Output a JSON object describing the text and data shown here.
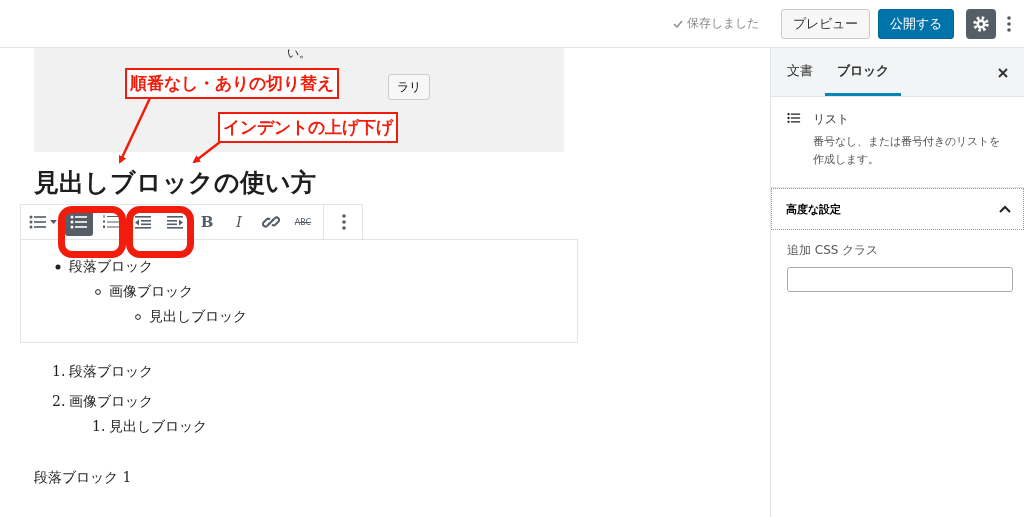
{
  "top_bar": {
    "save_status": "保存しました",
    "buttons": [
      {
        "kind": "secondary",
        "label": "プレビュー"
      },
      {
        "kind": "primary",
        "label": "公開する"
      }
    ],
    "settings_active": true
  },
  "editor": {
    "gallery": {
      "text": "い。",
      "button": "ラリ"
    },
    "heading": "見出しブロックの使い方",
    "toolbar": [
      {
        "kind": "list-type"
      },
      {
        "kind": "unordered",
        "selected": true
      },
      {
        "kind": "ordered",
        "selected": false
      },
      {
        "kind": "outdent"
      },
      {
        "kind": "indent"
      },
      {
        "kind": "bold",
        "label": "B"
      },
      {
        "kind": "italic",
        "label": "I"
      },
      {
        "kind": "link"
      },
      {
        "kind": "strike",
        "label": "ABC"
      },
      {
        "kind": "more"
      }
    ],
    "unordered_list": [
      {
        "text": "段落ブロック",
        "children": [
          {
            "text": "画像ブロック",
            "children": [
              {
                "text": "見出しブロック"
              }
            ]
          }
        ]
      }
    ],
    "ordered_list": [
      {
        "marker": "1.",
        "text": "段落ブロック"
      },
      {
        "marker": "2.",
        "text": "画像ブロック",
        "children": [
          {
            "marker": "1.",
            "text": "見出しブロック"
          }
        ]
      }
    ],
    "paragraph": "段落ブロック 1",
    "annotations": [
      {
        "text": "順番なし・ありの切り替え"
      },
      {
        "text": "インデントの上げ下げ"
      }
    ]
  },
  "sidebar": {
    "tabs": [
      {
        "label": "文書",
        "selected": false
      },
      {
        "label": "ブロック",
        "selected": true
      }
    ],
    "block": {
      "title": "リスト",
      "description": "番号なし、または番号付きのリストを作成します。"
    },
    "panel": {
      "title": "高度な設定",
      "expanded": true,
      "field_label": "追加 CSS クラス"
    }
  }
}
